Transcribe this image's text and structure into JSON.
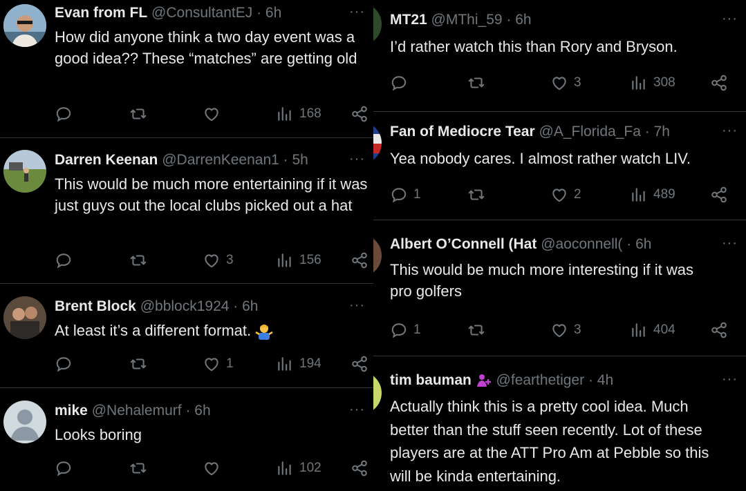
{
  "left": [
    {
      "name": "Evan from FL",
      "handle": "@ConsultantEJ",
      "time": "· 6h",
      "text": "How did anyone think a two day event was a good idea?? These “matches” are getting old",
      "replies": "",
      "retweets": "",
      "likes": "",
      "views": "168"
    },
    {
      "name": "Darren Keenan",
      "handle": "@DarrenKeenan1",
      "time": "· 5h",
      "text": "This would be much more entertaining if it was just guys out the local clubs picked out a hat",
      "replies": "",
      "retweets": "",
      "likes": "3",
      "views": "156"
    },
    {
      "name": "Brent Block",
      "handle": "@bblock1924",
      "time": "· 6h",
      "text": "At least it’s a different format.",
      "replies": "",
      "retweets": "",
      "likes": "1",
      "views": "194"
    },
    {
      "name": "mike",
      "handle": "@Nehalemurf",
      "time": "· 6h",
      "text": "Looks boring",
      "replies": "",
      "retweets": "",
      "likes": "",
      "views": "102"
    }
  ],
  "right": [
    {
      "name": "MT21",
      "handle": "@MThi_59",
      "time": "· 6h",
      "text": "I’d rather watch this than Rory and Bryson.",
      "replies": "",
      "retweets": "",
      "likes": "3",
      "views": "308"
    },
    {
      "name": "Fan of Mediocre Tear",
      "handle": "@A_Florida_Fa",
      "time": "· 7h",
      "text": "Yea nobody cares. I almost rather watch LIV.",
      "replies": "1",
      "retweets": "",
      "likes": "2",
      "views": "489"
    },
    {
      "name": "Albert O’Connell (Hat",
      "handle": "@aoconnell(",
      "time": "· 6h",
      "text": "This would be much more interesting if it was pro golfers",
      "replies": "1",
      "retweets": "",
      "likes": "3",
      "views": "404"
    },
    {
      "name": "tim bauman",
      "handle": "@fearthetiger",
      "time": "· 4h",
      "text": "Actually think this is a pretty cool idea. Much better than the stuff seen recently. Lot of these players are at the ATT Pro Am at Pebble so this will be kinda entertaining.",
      "replies": "",
      "retweets": "",
      "likes": "",
      "views": ""
    }
  ],
  "colors": {
    "background": "#000000",
    "text": "#e7e9ea",
    "muted": "#71767b",
    "divider": "#2f3336",
    "badge": "#c13fd1"
  },
  "icons": {
    "more": "more-dots-icon",
    "reply": "reply-icon",
    "retweet": "retweet-icon",
    "like": "like-icon",
    "views": "views-icon",
    "share": "share-icon"
  },
  "more_glyph": "···"
}
